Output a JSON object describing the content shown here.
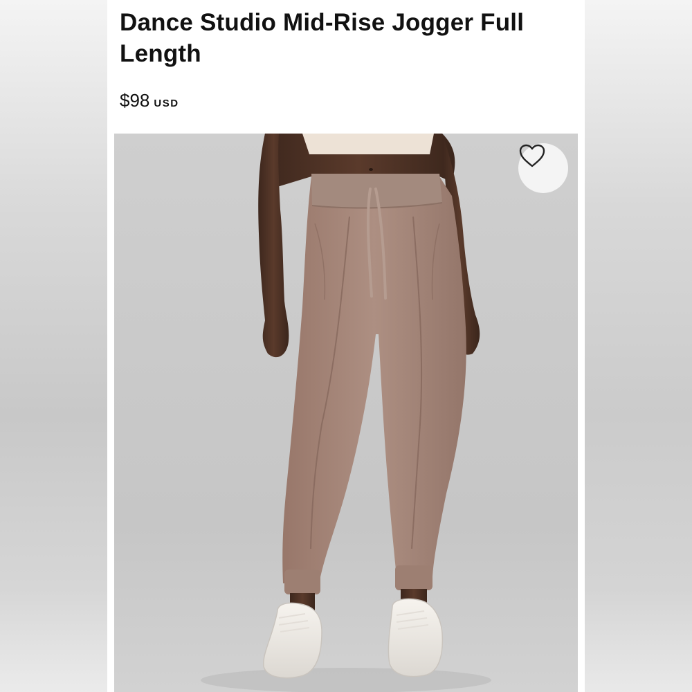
{
  "product": {
    "title": "Dance Studio Mid-Rise Jogger Full Length",
    "price": "$98",
    "currency": "USD",
    "favorite_icon": "heart-outline-icon"
  },
  "colors": {
    "jogger": "#a7887b",
    "background": "#c9c9c9",
    "text": "#111111"
  }
}
